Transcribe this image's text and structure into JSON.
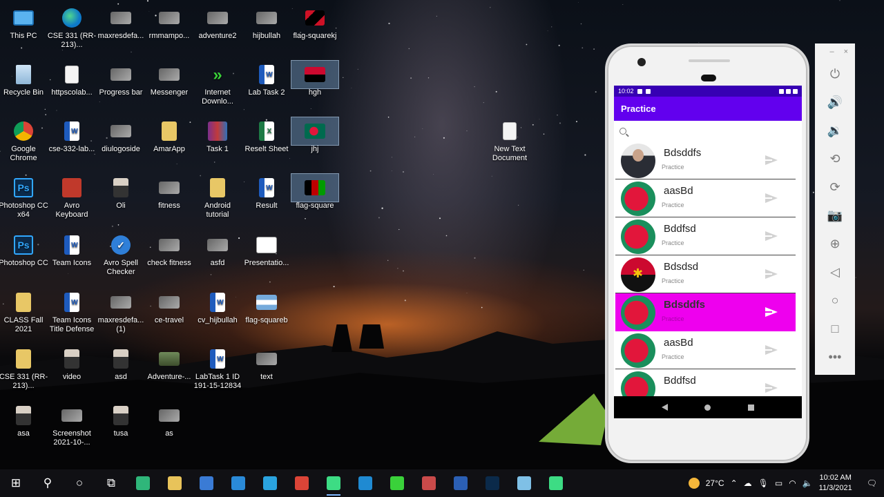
{
  "desktop": {
    "icons": [
      {
        "label": "This PC",
        "kind": "g-pc",
        "glyph": ""
      },
      {
        "label": "CSE 331 (RR-213)...",
        "kind": "g-edge",
        "glyph": ""
      },
      {
        "label": "maxresdefa...",
        "kind": "g-img",
        "glyph": ""
      },
      {
        "label": "rmmampo...",
        "kind": "g-img",
        "glyph": ""
      },
      {
        "label": "adventure2",
        "kind": "g-img",
        "glyph": ""
      },
      {
        "label": "hijbullah",
        "kind": "g-img",
        "glyph": ""
      },
      {
        "label": "flag-squarekj",
        "kind": "g-flag-ag",
        "glyph": ""
      },
      {
        "label": "Recycle Bin",
        "kind": "g-bin",
        "glyph": ""
      },
      {
        "label": "httpscolab...",
        "kind": "g-doc",
        "glyph": ""
      },
      {
        "label": "Progress bar",
        "kind": "g-img",
        "glyph": ""
      },
      {
        "label": "Messenger",
        "kind": "g-img",
        "glyph": ""
      },
      {
        "label": "Internet Downlo...",
        "kind": "g-idm",
        "glyph": "»"
      },
      {
        "label": "Lab Task 2",
        "kind": "g-word",
        "glyph": "W"
      },
      {
        "label": "hgh",
        "kind": "g-flag-ao",
        "glyph": "",
        "selected": true
      },
      {
        "label": "Google Chrome",
        "kind": "g-chrome",
        "glyph": ""
      },
      {
        "label": "cse-332-lab...",
        "kind": "g-word",
        "glyph": "W"
      },
      {
        "label": "diulogoside",
        "kind": "g-img",
        "glyph": ""
      },
      {
        "label": "AmarApp",
        "kind": "g-folder",
        "glyph": ""
      },
      {
        "label": "Task 1",
        "kind": "g-rar",
        "glyph": ""
      },
      {
        "label": "Reselt Sheet",
        "kind": "g-excel",
        "glyph": "X"
      },
      {
        "label": "jhj",
        "kind": "g-flag-bd",
        "glyph": "",
        "selected": true
      },
      {
        "label": "Photoshop CC x64",
        "kind": "g-ps",
        "glyph": "Ps"
      },
      {
        "label": "Avro Keyboard",
        "kind": "g-avro",
        "glyph": ""
      },
      {
        "label": "Oli",
        "kind": "g-person",
        "glyph": ""
      },
      {
        "label": "fitness",
        "kind": "g-img",
        "glyph": ""
      },
      {
        "label": "Android tutorial",
        "kind": "g-folder",
        "glyph": ""
      },
      {
        "label": "Result",
        "kind": "g-word",
        "glyph": "W"
      },
      {
        "label": "flag-square",
        "kind": "g-flag-af",
        "glyph": "",
        "selected": true
      },
      {
        "label": "Photoshop CC",
        "kind": "g-ps",
        "glyph": "Ps"
      },
      {
        "label": "Team Icons",
        "kind": "g-word",
        "glyph": "W"
      },
      {
        "label": "Avro Spell Checker",
        "kind": "g-check",
        "glyph": "✓"
      },
      {
        "label": "check fitness",
        "kind": "g-img",
        "glyph": ""
      },
      {
        "label": "asfd",
        "kind": "g-img",
        "glyph": ""
      },
      {
        "label": "Presentatio...",
        "kind": "g-ppt",
        "glyph": ""
      },
      {
        "label": "CLASS Fall 2021",
        "kind": "g-folder",
        "glyph": ""
      },
      {
        "label": "Team Icons Title Defense",
        "kind": "g-word",
        "glyph": "W"
      },
      {
        "label": "maxresdefa... (1)",
        "kind": "g-img",
        "glyph": ""
      },
      {
        "label": "ce-travel",
        "kind": "g-img",
        "glyph": ""
      },
      {
        "label": "cv_hijbullah",
        "kind": "g-word",
        "glyph": "W"
      },
      {
        "label": "flag-squareb",
        "kind": "g-flag-ar",
        "glyph": ""
      },
      {
        "label": "CSE 331 (RR-213)...",
        "kind": "g-folder",
        "glyph": ""
      },
      {
        "label": "video",
        "kind": "g-person",
        "glyph": ""
      },
      {
        "label": "asd",
        "kind": "g-person",
        "glyph": ""
      },
      {
        "label": "Adventure-...",
        "kind": "g-photo",
        "glyph": ""
      },
      {
        "label": "LabTask 1 ID 191-15-12834",
        "kind": "g-word",
        "glyph": "W"
      },
      {
        "label": "text",
        "kind": "g-img",
        "glyph": ""
      },
      {
        "label": "asa",
        "kind": "g-person",
        "glyph": ""
      },
      {
        "label": "Screenshot 2021-10-...",
        "kind": "g-img",
        "glyph": ""
      },
      {
        "label": "tusa",
        "kind": "g-person",
        "glyph": ""
      },
      {
        "label": "as",
        "kind": "g-img",
        "glyph": ""
      },
      {
        "label": "New Text Document",
        "kind": "g-doc",
        "glyph": ""
      }
    ]
  },
  "phone": {
    "status_time": "10:02",
    "app_title": "Practice",
    "rows": [
      {
        "name": "Bdsddfs",
        "subtitle": "Practice",
        "avatar": "av-person",
        "highlight": false
      },
      {
        "name": "aasBd",
        "subtitle": "Practice",
        "avatar": "av-bd",
        "highlight": false
      },
      {
        "name": "Bddfsd",
        "subtitle": "Practice",
        "avatar": "av-bd",
        "highlight": false
      },
      {
        "name": "Bdsdsd",
        "subtitle": "Practice",
        "avatar": "av-ao",
        "highlight": false
      },
      {
        "name": "Bdsddfs",
        "subtitle": "Practice",
        "avatar": "av-bd",
        "highlight": true
      },
      {
        "name": "aasBd",
        "subtitle": "Practice",
        "avatar": "av-bd",
        "highlight": false
      },
      {
        "name": "Bddfsd",
        "subtitle": "",
        "avatar": "av-bd",
        "highlight": false
      }
    ],
    "colors": {
      "status_bar": "#3700b3",
      "app_bar": "#6200ee",
      "highlight": "#ee00ee"
    }
  },
  "emulator_toolbar": {
    "window_controls": [
      "–",
      "×"
    ],
    "buttons": [
      {
        "name": "power-icon",
        "glyph": "⏻"
      },
      {
        "name": "volume-up-icon",
        "glyph": "🔊"
      },
      {
        "name": "volume-down-icon",
        "glyph": "🔉"
      },
      {
        "name": "rotate-left-icon",
        "glyph": "⟲"
      },
      {
        "name": "rotate-right-icon",
        "glyph": "⟳"
      },
      {
        "name": "camera-icon",
        "glyph": "📷"
      },
      {
        "name": "zoom-icon",
        "glyph": "⊕"
      },
      {
        "name": "back-icon",
        "glyph": "◁"
      },
      {
        "name": "home-icon",
        "glyph": "○"
      },
      {
        "name": "overview-icon",
        "glyph": "□"
      },
      {
        "name": "more-icon",
        "glyph": "•••"
      }
    ]
  },
  "taskbar": {
    "items": [
      {
        "name": "start-icon",
        "glyph": "⊞",
        "color": "#ffffff"
      },
      {
        "name": "search-icon",
        "glyph": "⚲",
        "color": "#ffffff"
      },
      {
        "name": "cortana-icon",
        "glyph": "○",
        "color": "#ffffff"
      },
      {
        "name": "task-view-icon",
        "glyph": "⧉",
        "color": "#ffffff"
      },
      {
        "name": "edge-icon",
        "glyph": "",
        "color": "#2fb67a"
      },
      {
        "name": "file-explorer-icon",
        "glyph": "",
        "color": "#e8c35a"
      },
      {
        "name": "store-icon",
        "glyph": "",
        "color": "#3a7bd5"
      },
      {
        "name": "mail-icon",
        "glyph": "",
        "color": "#2a8ad8"
      },
      {
        "name": "telegram-icon",
        "glyph": "",
        "color": "#2aa3df"
      },
      {
        "name": "chrome-icon",
        "glyph": "",
        "color": "#db4437"
      },
      {
        "name": "android-studio-icon",
        "glyph": "",
        "color": "#3ddc84",
        "active": true
      },
      {
        "name": "vscode-icon",
        "glyph": "",
        "color": "#1f8ad2"
      },
      {
        "name": "idm-icon",
        "glyph": "",
        "color": "#3ad13a"
      },
      {
        "name": "snipping-icon",
        "glyph": "",
        "color": "#c94a4a"
      },
      {
        "name": "word-icon",
        "glyph": "",
        "color": "#2b5fb4"
      },
      {
        "name": "photoshop-icon",
        "glyph": "",
        "color": "#0b2a4a"
      },
      {
        "name": "notepad-icon",
        "glyph": "",
        "color": "#7fc0e6"
      },
      {
        "name": "emulator-icon",
        "glyph": "",
        "color": "#3ddc84"
      }
    ],
    "weather": "27°C",
    "time": "10:02 AM",
    "date": "11/3/2021"
  }
}
